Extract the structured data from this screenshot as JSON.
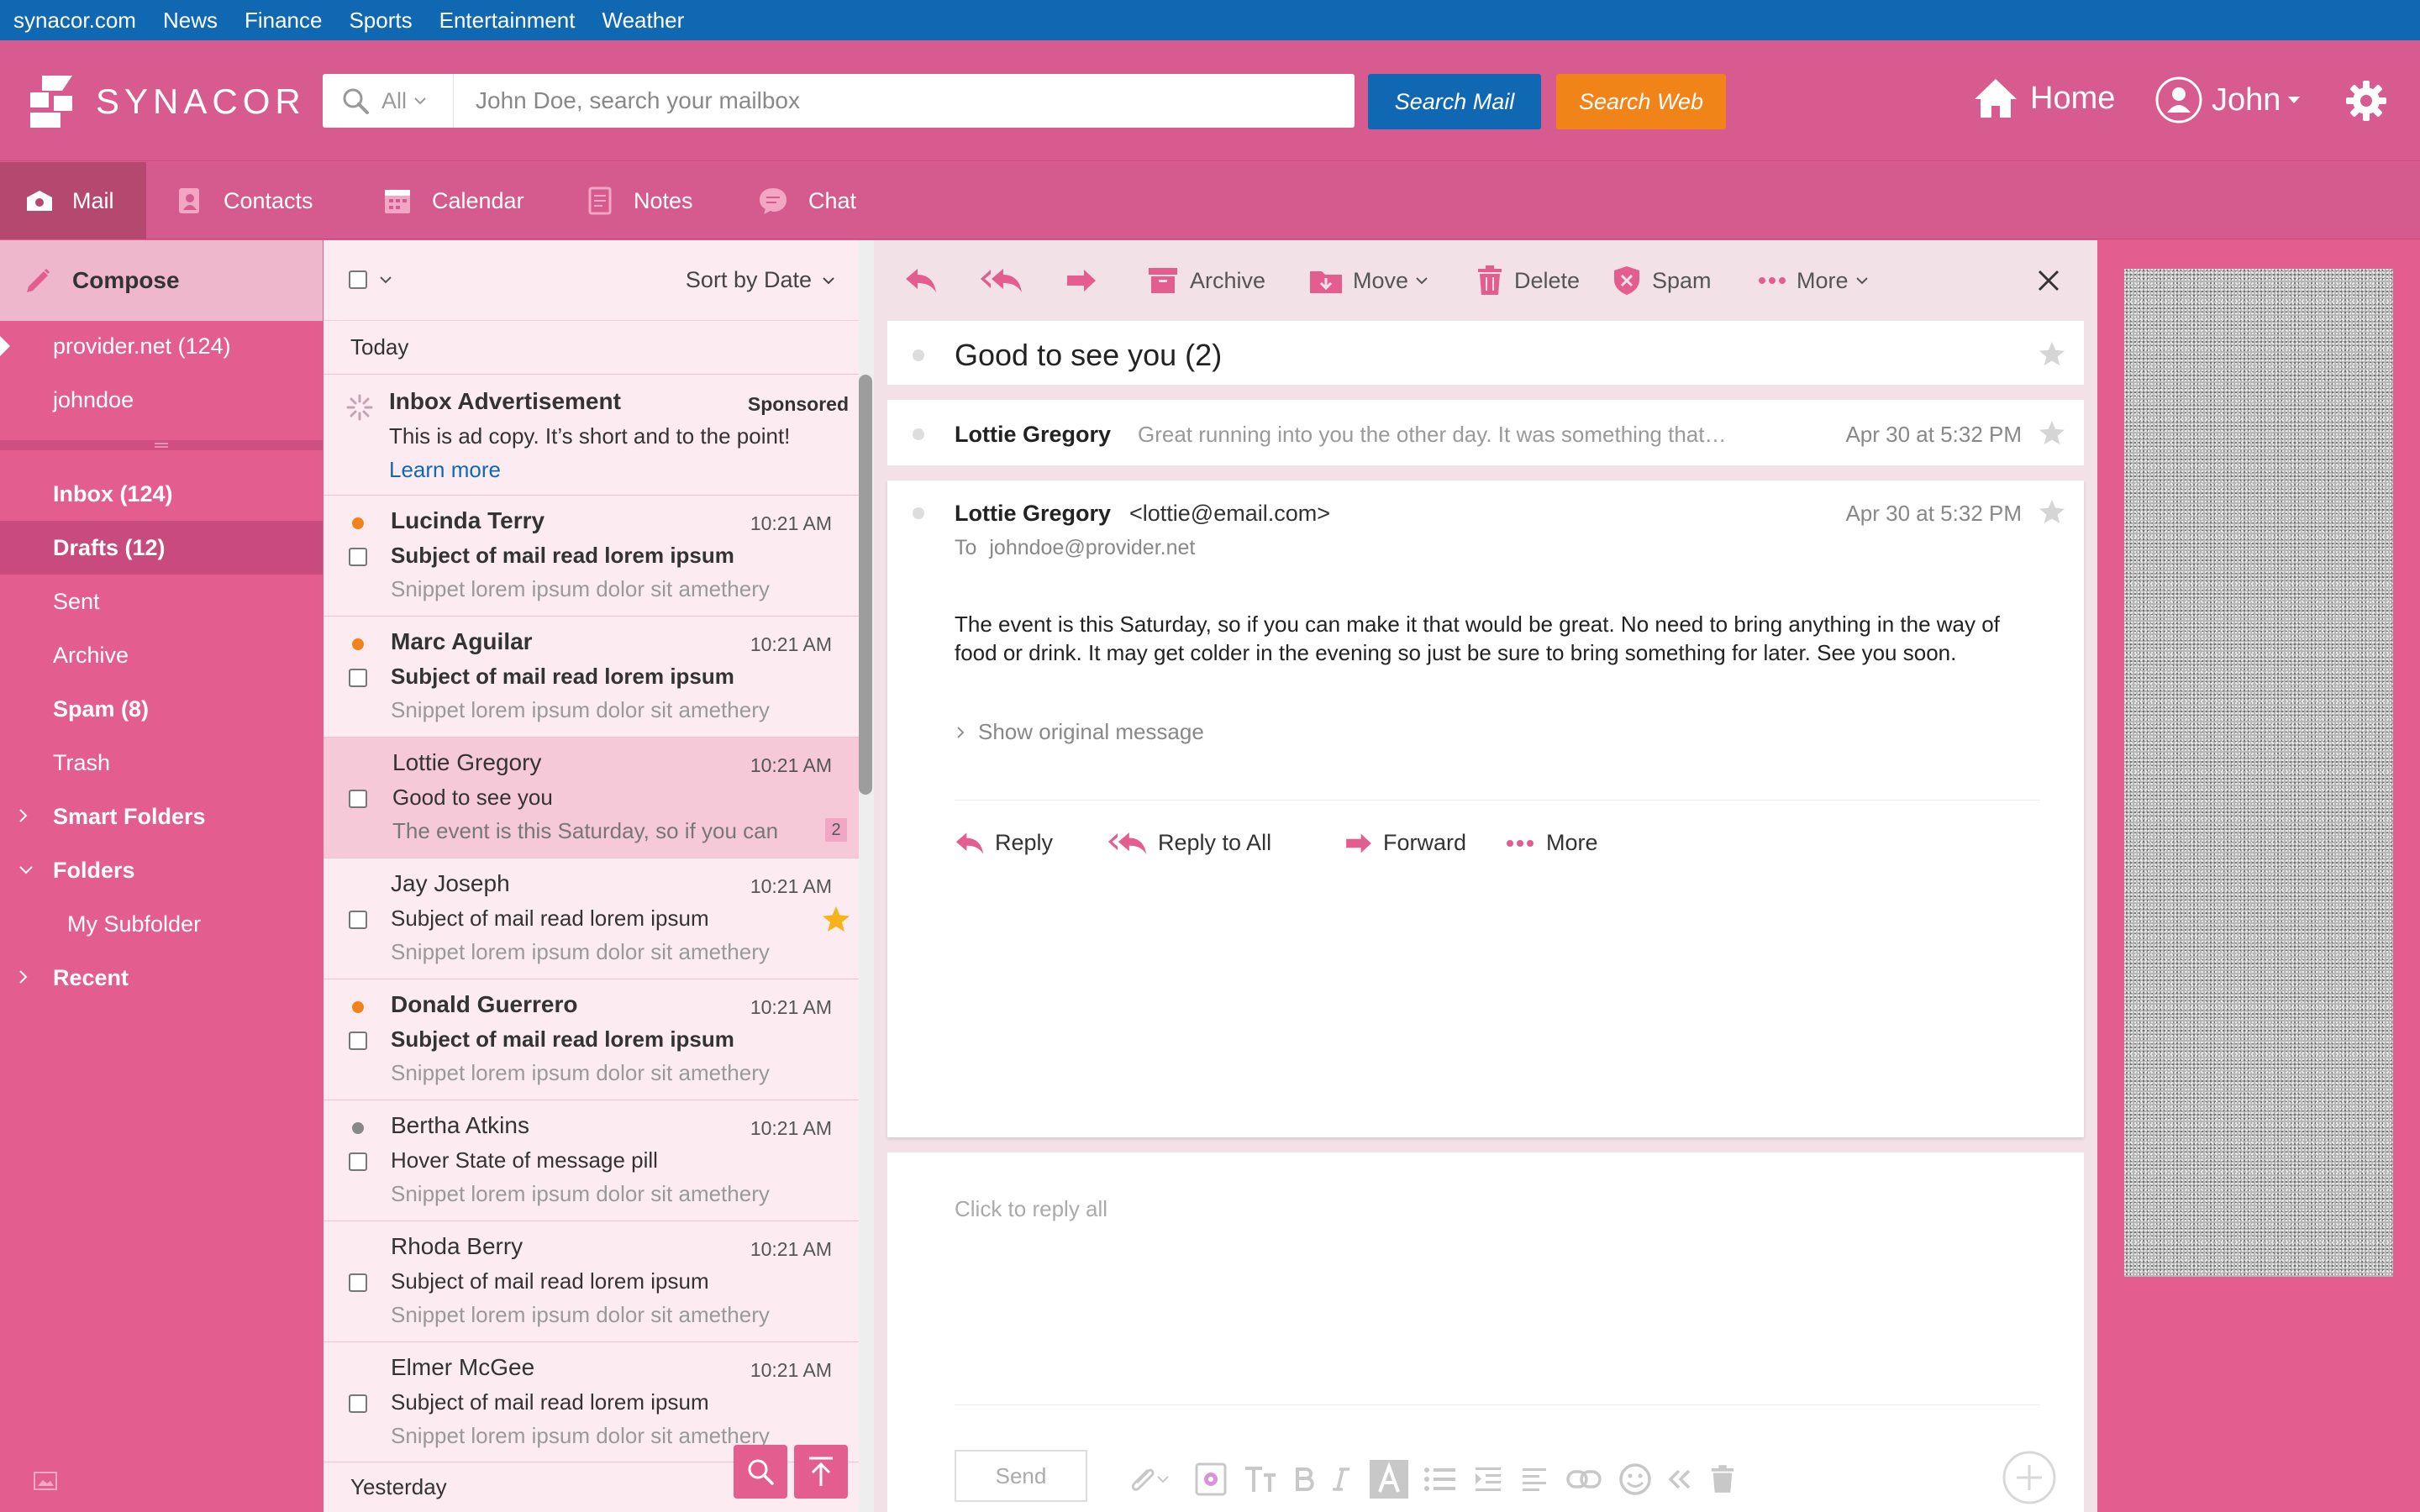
{
  "portal": {
    "links": [
      "synacor.com",
      "News",
      "Finance",
      "Sports",
      "Entertainment",
      "Weather"
    ]
  },
  "header": {
    "brand": "SYNACOR",
    "search_scope": "All",
    "search_placeholder": "John Doe, search your mailbox",
    "search_mail_label": "Search Mail",
    "search_web_label": "Search Web",
    "home_label": "Home",
    "user_name": "John"
  },
  "app_tabs": [
    {
      "label": "Mail",
      "active": true
    },
    {
      "label": "Contacts"
    },
    {
      "label": "Calendar"
    },
    {
      "label": "Notes"
    },
    {
      "label": "Chat"
    }
  ],
  "sidebar": {
    "compose_label": "Compose",
    "accounts": [
      "provider.net (124)",
      "johndoe"
    ],
    "folders": [
      "Inbox (124)",
      "Drafts (12)",
      "Sent",
      "Archive",
      "Spam (8)",
      "Trash",
      "Smart Folders",
      "Folders",
      "My Subfolder",
      "Recent"
    ],
    "selected_folder": "Drafts (12)"
  },
  "message_list": {
    "sort_label": "Sort by Date",
    "group_today": "Today",
    "group_yesterday": "Yesterday",
    "ad": {
      "title": "Inbox Advertisement",
      "badge": "Sponsored",
      "copy": "This is ad copy. It’s short and to the point!",
      "link": "Learn more"
    },
    "messages": [
      {
        "sender": "Lucinda Terry",
        "time": "10:21 AM",
        "subject": "Subject of mail read lorem ipsum",
        "snippet": "Snippet lorem ipsum dolor sit amethery",
        "unread": true
      },
      {
        "sender": "Marc Aguilar",
        "time": "10:21 AM",
        "subject": "Subject of mail read lorem ipsum",
        "snippet": "Snippet lorem ipsum dolor sit amethery",
        "unread": true
      },
      {
        "sender": "Lottie Gregory",
        "time": "10:21 AM",
        "subject": "Good to see you",
        "snippet": "The event is this Saturday, so if you can",
        "count": "2",
        "selected": true
      },
      {
        "sender": "Jay Joseph",
        "time": "10:21 AM",
        "subject": "Subject of mail read lorem ipsum",
        "snippet": "Snippet lorem ipsum dolor sit amethery",
        "starred": true
      },
      {
        "sender": "Donald Guerrero",
        "time": "10:21 AM",
        "subject": "Subject of mail read lorem ipsum",
        "snippet": "Snippet lorem ipsum dolor sit amethery",
        "unread": true
      },
      {
        "sender": "Bertha Atkins",
        "time": "10:21 AM",
        "subject": "Hover State of message pill",
        "snippet": "Snippet lorem ipsum dolor sit amethery"
      },
      {
        "sender": "Rhoda Berry",
        "time": "10:21 AM",
        "subject": "Subject of mail read lorem ipsum",
        "snippet": "Snippet lorem ipsum dolor sit amethery"
      },
      {
        "sender": "Elmer McGee",
        "time": "10:21 AM",
        "subject": "Subject of mail read lorem ipsum",
        "snippet": "Snippet lorem ipsum dolor sit amethery"
      }
    ]
  },
  "toolbar": {
    "archive": "Archive",
    "move": "Move",
    "delete": "Delete",
    "spam": "Spam",
    "more": "More"
  },
  "conversation": {
    "subject": "Good to see you (2)",
    "collapsed": {
      "sender": "Lottie Gregory",
      "snippet": "Great running into you the other day. It was something that…",
      "date": "Apr 30 at 5:32 PM"
    },
    "expanded": {
      "sender": "Lottie Gregory",
      "email": "<lottie@email.com>",
      "date": "Apr 30 at 5:32 PM",
      "to_label": "To",
      "to": "johndoe@provider.net",
      "body_line1": "The event is this Saturday, so if you can make it that would be great. No need to bring anything in the way of",
      "body_line2": "food or drink. It may get colder in the evening so just be sure to bring something for later. See you soon.",
      "show_original": "Show original message",
      "actions": {
        "reply": "Reply",
        "reply_all": "Reply to All",
        "forward": "Forward",
        "more": "More"
      }
    },
    "reply_placeholder": "Click to reply all",
    "send_label": "Send"
  },
  "colors": {
    "portal_bar": "#0f68b1",
    "brand_pink": "#e45d8f",
    "search_web": "#f08418",
    "accent_icon": "#e45d8f",
    "unread_dot": "#f08418",
    "star": "#f6b41c"
  }
}
